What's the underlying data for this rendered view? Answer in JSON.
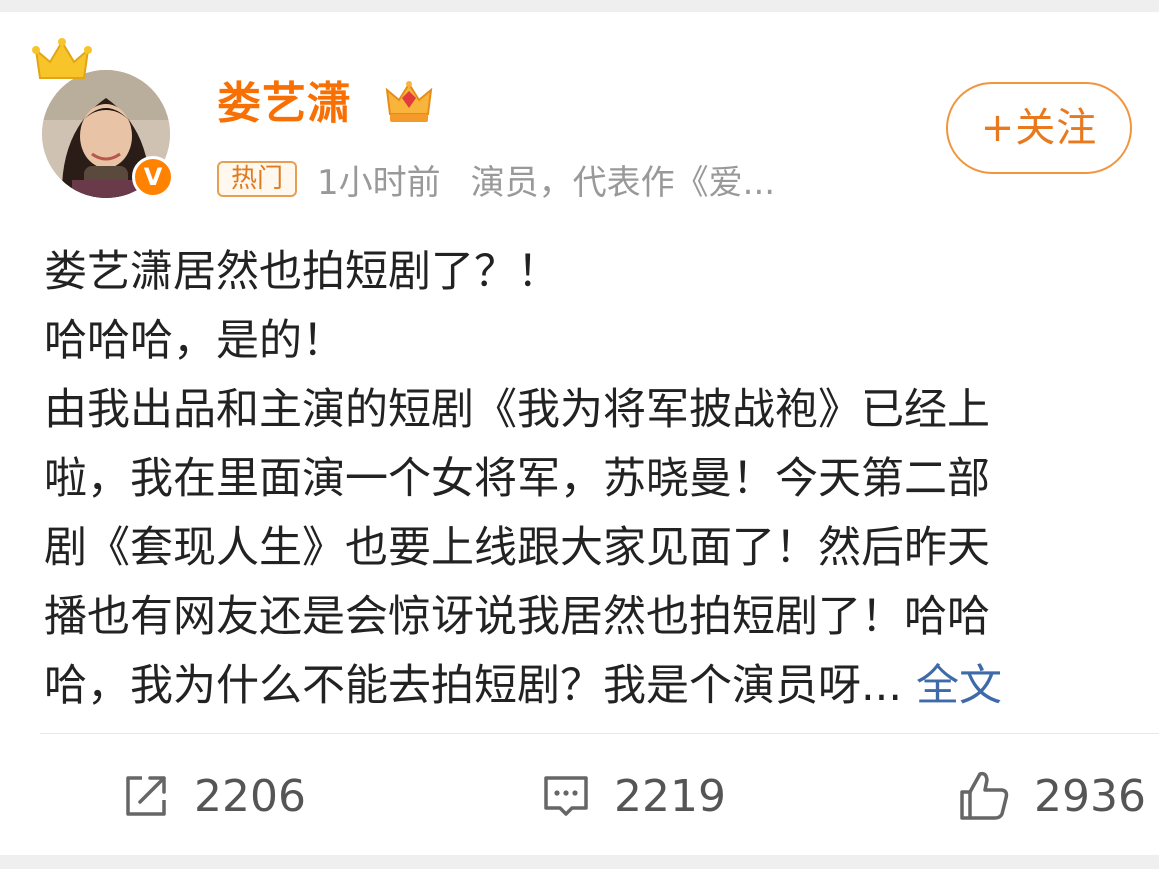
{
  "post": {
    "user": {
      "name": "娄艺潇",
      "verified_badge": "V",
      "crown_icon": "crown-icon",
      "member_icon": "member-crown-icon"
    },
    "meta": {
      "hot_badge": "热门",
      "time": "1小时前",
      "description": "演员，代表作《爱..."
    },
    "follow_label": "+关注",
    "content_lines": [
      "娄艺潇居然也拍短剧了？！",
      "哈哈哈，是的！",
      "由我出品和主演的短剧《我为将军披战袍》已经上",
      "啦，我在里面演一个女将军，苏晓曼！今天第二部",
      "剧《套现人生》也要上线跟大家见面了！然后昨天",
      "播也有网友还是会惊讶说我居然也拍短剧了！哈哈",
      "哈，我为什么不能去拍短剧？我是个演员呀..."
    ],
    "fulltext_link": "全文",
    "actions": {
      "repost_count": "2206",
      "comment_count": "2219",
      "like_count": "2936"
    }
  },
  "colors": {
    "username": "#f86f03",
    "follow": "#e8791e",
    "link": "#3e6aa8",
    "verified": "#ff8200"
  }
}
